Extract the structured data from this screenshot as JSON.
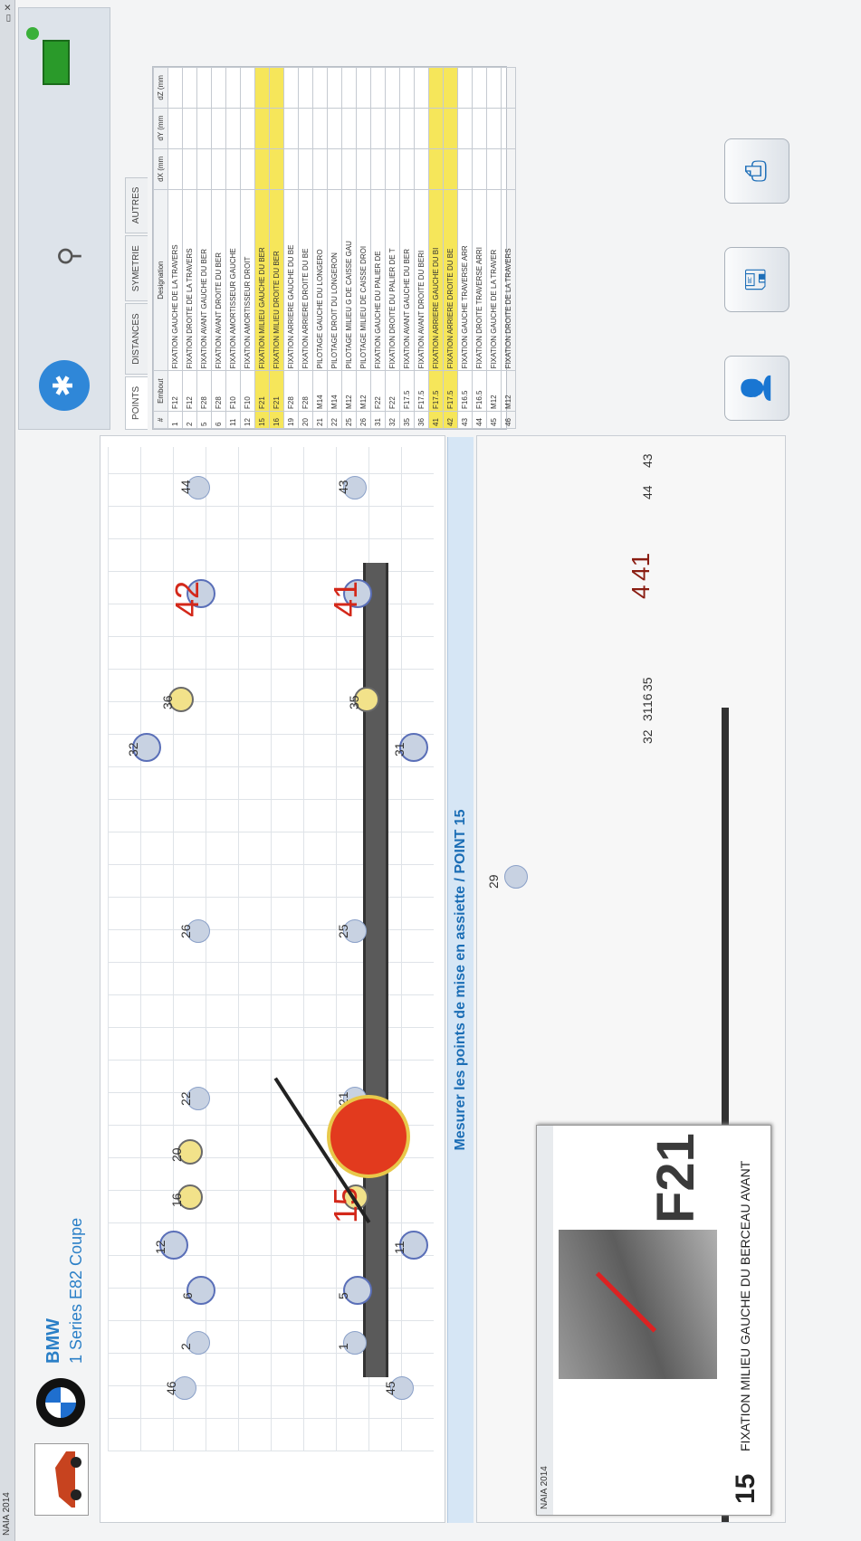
{
  "window": {
    "title": "NAIA 2014",
    "popup_title": "NAIA 2014"
  },
  "header": {
    "brand": "BMW",
    "model": "1 Series E82 Coupe"
  },
  "status_line": "Mesurer les points de mise en assiette / POINT 15",
  "plan_points": [
    "46",
    "2",
    "1",
    "45",
    "6",
    "5",
    "12",
    "11",
    "16",
    "15",
    "20",
    "22",
    "21",
    "26",
    "25",
    "32",
    "31",
    "36",
    "35",
    "42",
    "41",
    "44",
    "43"
  ],
  "view3d_points": [
    "29",
    "32",
    "31",
    "16",
    "35",
    "4",
    "41",
    "44",
    "43"
  ],
  "popup": {
    "point_number": "15",
    "description": "FIXATION MILIEU GAUCHE DU BERCEAU AVANT",
    "code": "F21"
  },
  "right_panel": {
    "tabs": [
      "POINTS",
      "DISTANCES",
      "SYMETRIE",
      "AUTRES"
    ],
    "table": {
      "headers": [
        "#",
        "Embout",
        "Designation",
        "dX (mm",
        "dY (mm",
        "dZ (mm"
      ],
      "rows": [
        [
          "1",
          "F12",
          "FIXATION GAUCHE DE LA TRAVERS",
          "",
          "",
          ""
        ],
        [
          "2",
          "F12",
          "FIXATION DROITE DE LA TRAVERS",
          "",
          "",
          ""
        ],
        [
          "5",
          "F28",
          "FIXATION AVANT GAUCHE DU BER",
          "",
          "",
          ""
        ],
        [
          "6",
          "F28",
          "FIXATION AVANT DROITE DU BER",
          "",
          "",
          ""
        ],
        [
          "11",
          "F10",
          "FIXATION AMORTISSEUR GAUCHE",
          "",
          "",
          ""
        ],
        [
          "12",
          "F10",
          "FIXATION AMORTISSEUR DROIT",
          "",
          "",
          ""
        ],
        [
          "15",
          "F21",
          "FIXATION MILIEU GAUCHE DU BER",
          "",
          "",
          ""
        ],
        [
          "16",
          "F21",
          "FIXATION MILIEU DROITE DU BER",
          "",
          "",
          ""
        ],
        [
          "19",
          "F28",
          "FIXATION ARRIERE GAUCHE DU BE",
          "",
          "",
          ""
        ],
        [
          "20",
          "F28",
          "FIXATION ARRIERE DROITE DU BE",
          "",
          "",
          ""
        ],
        [
          "21",
          "M14",
          "PILOTAGE GAUCHE DU LONGERO",
          "",
          "",
          ""
        ],
        [
          "22",
          "M14",
          "PILOTAGE DROIT DU LONGERON",
          "",
          "",
          ""
        ],
        [
          "25",
          "M12",
          "PILOTAGE MILIEU G DE CAISSE GAU",
          "",
          "",
          ""
        ],
        [
          "26",
          "M12",
          "PILOTAGE MILIEU DE CAISSE DROI",
          "",
          "",
          ""
        ],
        [
          "31",
          "F22",
          "FIXATION GAUCHE DU PALIER DE",
          "",
          "",
          ""
        ],
        [
          "32",
          "F22",
          "FIXATION DROITE DU PALIER DE T",
          "",
          "",
          ""
        ],
        [
          "35",
          "F17.5",
          "FIXATION AVANT GAUCHE DU BER",
          "",
          "",
          ""
        ],
        [
          "36",
          "F17.5",
          "FIXATION AVANT DROITE DU BERI",
          "",
          "",
          ""
        ],
        [
          "41",
          "F17.5",
          "FIXATION ARRIERE GAUCHE DU BI",
          "",
          "",
          ""
        ],
        [
          "42",
          "F17.5",
          "FIXATION ARRIERE DROITE DU BE",
          "",
          "",
          ""
        ],
        [
          "43",
          "F16.5",
          "FIXATION GAUCHE TRAVERSE ARR",
          "",
          "",
          ""
        ],
        [
          "44",
          "F16.5",
          "FIXATION DROITE TRAVERSE ARRI",
          "",
          "",
          ""
        ],
        [
          "45",
          "M12",
          "FIXATION GAUCHE DE LA TRAVER",
          "",
          "",
          ""
        ],
        [
          "46",
          "M12",
          "FIXATION DROITE DE LA TRAVERS",
          "",
          "",
          ""
        ]
      ],
      "highlighted_rows": [
        "15",
        "16",
        "41",
        "42"
      ]
    }
  },
  "colors": {
    "accent": "#1a6db5",
    "highlight": "#f6e65a",
    "probe": "#e23a1e"
  }
}
